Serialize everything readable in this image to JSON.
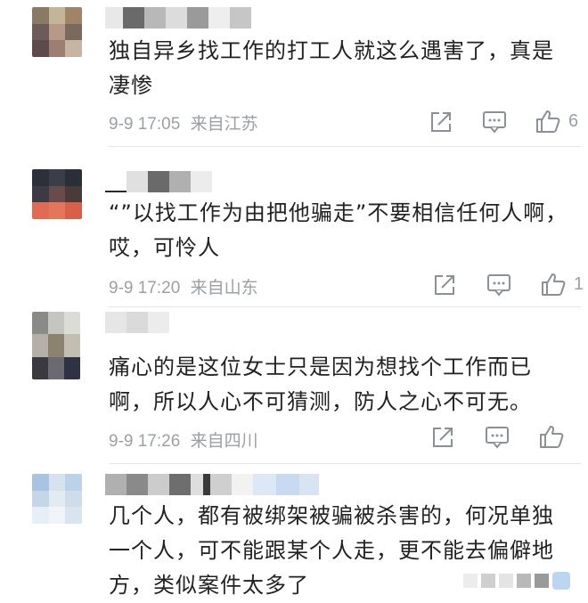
{
  "comments": [
    {
      "text_line1": "独自异乡找工作的打工人就这么遇害了，真是",
      "text_line2": "凄惨",
      "date": "9-9 17:05",
      "location": "来自江苏",
      "likes": "6"
    },
    {
      "text_line1": "“”以找工作为由把他骗走”不要相信任何人啊，",
      "text_line2": "哎，可怜人",
      "date": "9-9 17:20",
      "location": "来自山东",
      "likes": "1"
    },
    {
      "text_line1": "痛心的是这位女士只是因为想找个工作而已",
      "text_line2": "啊，所以人心不可猜测，防人之心不可无。",
      "date": "9-9 17:26",
      "location": "来自四川",
      "likes": ""
    },
    {
      "text_line1": "几个人，都有被绑架被骗被杀害的，何况单独",
      "text_line2": "一个人，可不能跟某个人走，更不能去偏僻地",
      "text_line3": "方，类似案件太多了"
    }
  ],
  "icons": {
    "share": "share-icon",
    "comment": "comment-icon",
    "like": "thumb-up-icon"
  },
  "colors": {
    "text": "#222222",
    "meta": "#9aa0a6",
    "icon": "#8a9098"
  }
}
